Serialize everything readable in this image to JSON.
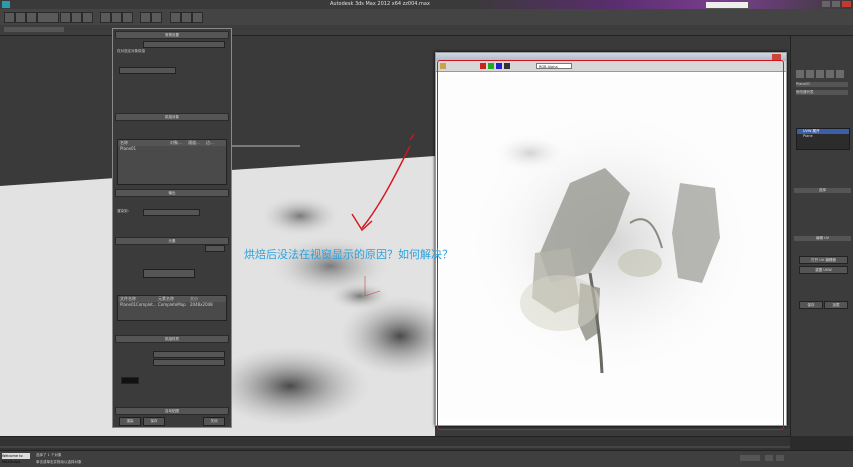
{
  "app": {
    "title": "Autodesk 3ds Max  2012 x64    zz004.max",
    "search_placeholder": "键入关键字或短语"
  },
  "render_setup": {
    "headers": {
      "common": "常规设置",
      "objects": "烘焙对象",
      "output": "输出",
      "baked_material": "烘焙材质",
      "auto_mapping": "自动贴图"
    },
    "table_headers": [
      "名称",
      "对象...",
      "通道...",
      "边..."
    ],
    "table_row": [
      "Plane01"
    ],
    "output_headers": [
      "文件名称",
      "元素名称",
      "大小"
    ],
    "output_row": [
      "Plane01Complet...",
      "CompleteMap",
      "2048x2048"
    ],
    "labels": {
      "selected_only": "仅对选定对象烘焙",
      "render_to": "渲染到：",
      "elements": "元素",
      "render_button": "渲染",
      "render_frame": "保存",
      "close_button": "关闭"
    }
  },
  "frame_window": {
    "toolbar_items": [
      "RGB Alpha"
    ]
  },
  "annotation": {
    "text": "烘焙后没法在视窗显示的原因？如何解决？"
  },
  "command_panel": {
    "name_field": "Plane01",
    "modifier_list": "修改器列表",
    "stack_items": [
      "UVW 展开",
      "Plane"
    ],
    "buttons": [
      "选择",
      "编辑 UV",
      "打开 UV 编辑器",
      "重置 UVW",
      "保存",
      "加载"
    ]
  },
  "status": {
    "selected_text": "选择了 1 个对象",
    "hint_text": "单击或单击并拖动以选择对象",
    "welcome": "Welcome to MAXScript."
  },
  "colors": {
    "annotation": "#2aa2df",
    "outline_red": "#d6141c",
    "title_purple": "#7a3f8e"
  }
}
